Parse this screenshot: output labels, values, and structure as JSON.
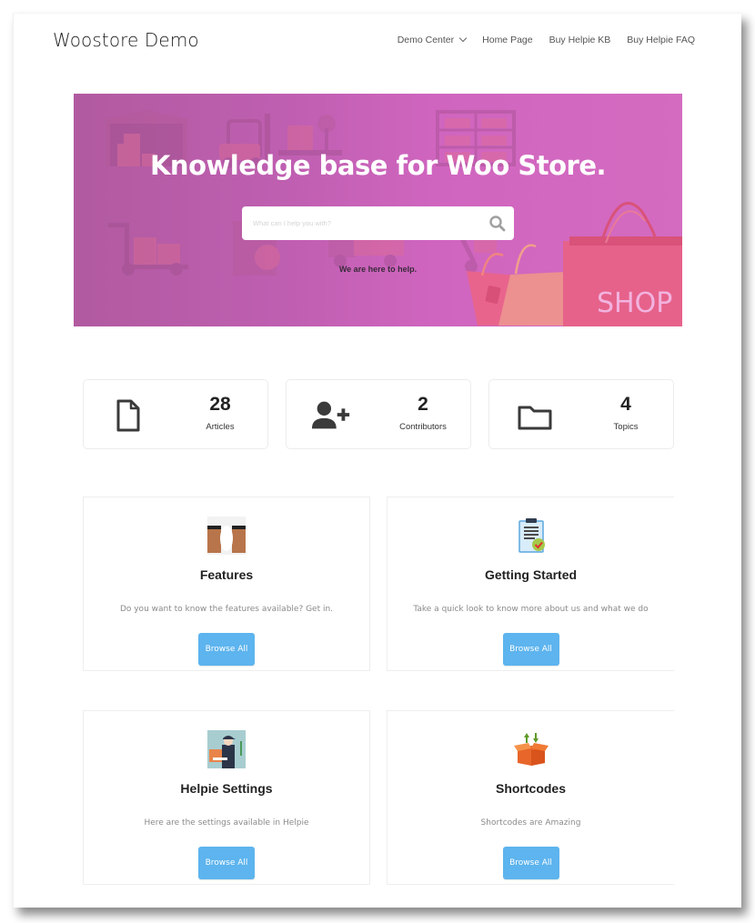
{
  "header": {
    "site_title": "Woostore Demo",
    "nav": [
      {
        "label": "Demo Center",
        "has_dropdown": true
      },
      {
        "label": "Home Page"
      },
      {
        "label": "Buy Helpie KB"
      },
      {
        "label": "Buy Helpie FAQ"
      }
    ]
  },
  "hero": {
    "title": "Knowledge base for Woo Store.",
    "search_placeholder": "What can I help you with?",
    "search_value": "",
    "subtitle": "We are here to help.",
    "banner_text": "SHOP",
    "colors": {
      "gradient_start": "#b15aa0",
      "gradient_end": "#d46bc0"
    }
  },
  "stats": [
    {
      "icon": "document-icon",
      "value": "28",
      "label": "Articles"
    },
    {
      "icon": "add-user-icon",
      "value": "2",
      "label": "Contributors"
    },
    {
      "icon": "folder-icon",
      "value": "4",
      "label": "Topics"
    }
  ],
  "categories": [
    {
      "icon": "boxes-light-image",
      "title": "Features",
      "description": "Do you want to know the features available? Get in.",
      "button": "Browse All"
    },
    {
      "icon": "clipboard-check-image",
      "title": "Getting Started",
      "description": "Take a quick look to know more about us and what we do",
      "button": "Browse All"
    },
    {
      "icon": "delivery-person-image",
      "title": "Helpie Settings",
      "description": "Here are the settings available in Helpie",
      "button": "Browse All"
    },
    {
      "icon": "open-box-arrows-image",
      "title": "Shortcodes",
      "description": "Shortcodes are Amazing",
      "button": "Browse All"
    }
  ],
  "colors": {
    "accent_button": "#5db4ee"
  }
}
